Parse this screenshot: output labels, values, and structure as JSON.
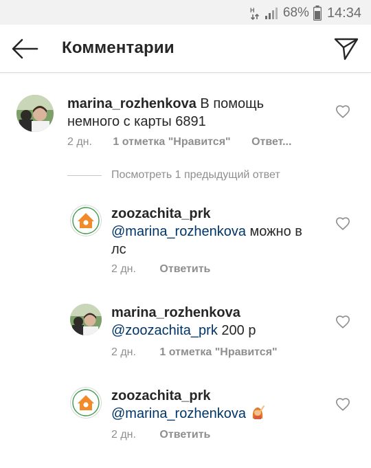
{
  "status_bar": {
    "battery_percent": "68%",
    "time": "14:34"
  },
  "header": {
    "title": "Комментарии",
    "back_icon": "arrow-left-icon",
    "send_icon": "paper-plane-icon"
  },
  "comments": [
    {
      "username": "marina_rozhenkova",
      "mention": "",
      "text": "В помощь немного с карты 6891",
      "time": "2 дн.",
      "likes": "1 отметка \"Нравится\"",
      "reply": "Ответ..."
    }
  ],
  "view_previous": "Посмотреть 1 предыдущий ответ",
  "replies": [
    {
      "username": "zoozachita_prk",
      "mention": "@marina_rozhenkova",
      "text": "можно в лс",
      "time": "2 дн.",
      "reply": "Ответить"
    },
    {
      "username": "marina_rozhenkova",
      "mention": "@zoozachita_prk",
      "text": "200 р",
      "time": "2 дн.",
      "likes": "1 отметка \"Нравится\""
    },
    {
      "username": "zoozachita_prk",
      "mention": "@marina_rozhenkova",
      "text": "",
      "emoji": "girl-raising-hand-emoji",
      "time": "2 дн.",
      "reply": "Ответить"
    }
  ],
  "colors": {
    "text": "#262626",
    "secondary": "#8e8e8e",
    "mention": "#003569",
    "status_bar_bg": "#f2f2f2",
    "logo_orange": "#f08a2b",
    "logo_green": "#3a9a4a"
  }
}
